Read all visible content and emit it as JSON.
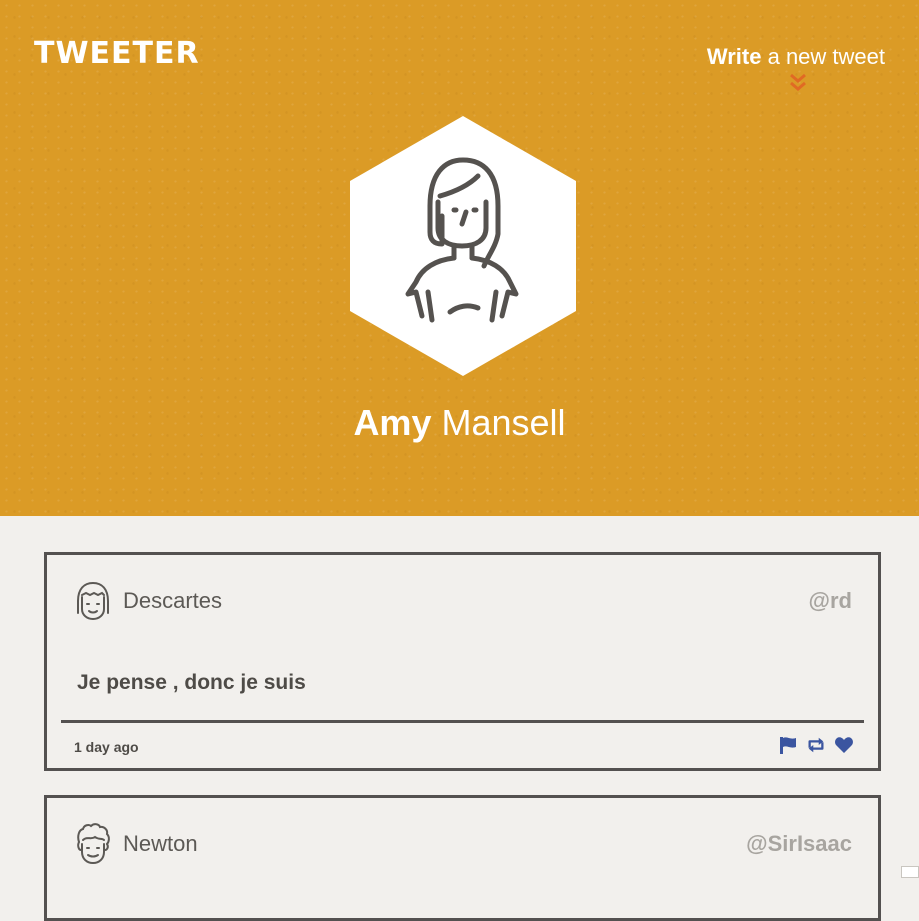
{
  "header": {
    "logo": "TWEETER",
    "compose": {
      "strong": "Write",
      "rest": "a new tweet"
    }
  },
  "profile": {
    "first_name": "Amy",
    "last_name": "Mansell"
  },
  "colors": {
    "header_bg": "#db9b26",
    "page_bg": "#f2f0ed",
    "chevron": "#e06a24",
    "action_icons": "#3b55a0",
    "border": "#545150"
  },
  "tweets": [
    {
      "name": "Descartes",
      "handle": "@rd",
      "content": "Je pense , donc je suis",
      "time": "1 day ago",
      "avatar_icon": "girl-avatar-icon",
      "actions": [
        "flag-icon",
        "retweet-icon",
        "heart-icon"
      ]
    },
    {
      "name": "Newton",
      "handle": "@SirIsaac",
      "avatar_icon": "curly-hair-avatar-icon"
    }
  ]
}
